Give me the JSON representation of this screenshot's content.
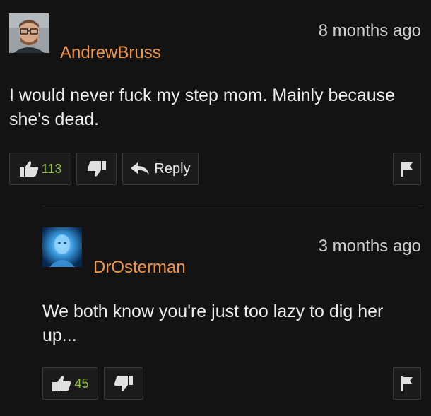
{
  "comments": [
    {
      "username": "AndrewBruss",
      "time": "8 months ago",
      "text": "I would never fuck my step mom. Mainly because she's dead.",
      "likes": "113",
      "reply_label": "Reply",
      "avatar_icon": "man-with-glasses-avatar"
    },
    {
      "username": "DrOsterman",
      "time": "3 months ago",
      "text": "We both know you're just too lazy to dig her up...",
      "likes": "45",
      "avatar_icon": "blue-glowing-man-avatar"
    }
  ],
  "colors": {
    "background": "#131313",
    "username": "#f0964a",
    "like_count": "#8fbf3e"
  }
}
